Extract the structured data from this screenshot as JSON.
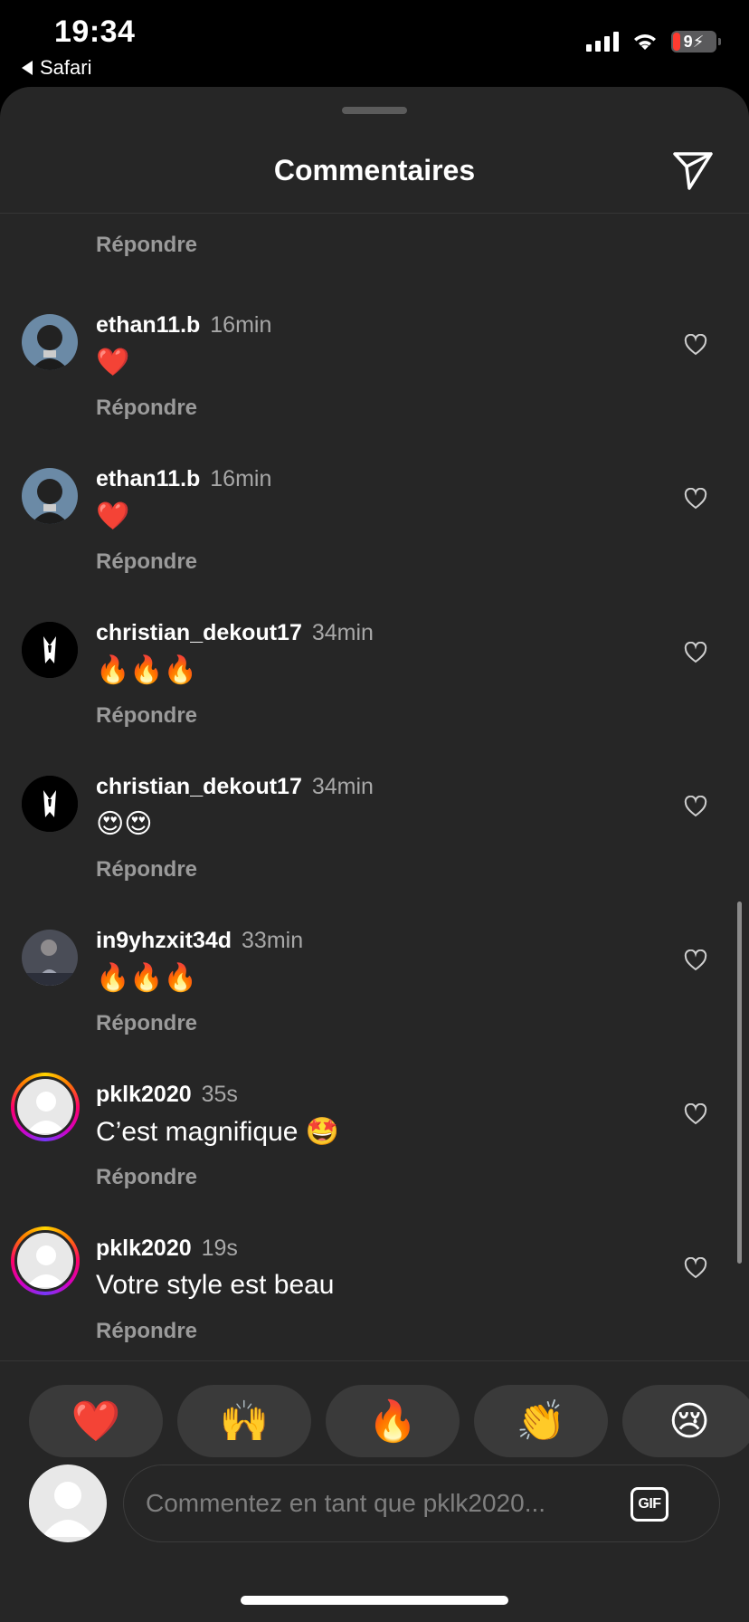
{
  "status_bar": {
    "time": "19:34",
    "back_app": "Safari",
    "battery": "9"
  },
  "header": {
    "title": "Commentaires"
  },
  "comments_top_reply": "Répondre",
  "comments": [
    {
      "user": "ethan11.b",
      "time": "16min",
      "text": "❤️",
      "reply": "Répondre",
      "avatar": "photo"
    },
    {
      "user": "ethan11.b",
      "time": "16min",
      "text": "❤️",
      "reply": "Répondre",
      "avatar": "photo"
    },
    {
      "user": "christian_dekout17",
      "time": "34min",
      "text": "🔥🔥🔥",
      "reply": "Répondre",
      "avatar": "tux"
    },
    {
      "user": "christian_dekout17",
      "time": "34min",
      "text": "😍😍",
      "reply": "Répondre",
      "avatar": "tux"
    },
    {
      "user": "in9yhzxit34d",
      "time": "33min",
      "text": "🔥🔥🔥",
      "reply": "Répondre",
      "avatar": "photo2"
    },
    {
      "user": "pklk2020",
      "time": "35s",
      "text": "C’est magnifique 🤩",
      "reply": "Répondre",
      "avatar": "default-ring"
    },
    {
      "user": "pklk2020",
      "time": "19s",
      "text": "Votre style est beau",
      "reply": "Répondre",
      "avatar": "default-ring"
    }
  ],
  "reactions": [
    "❤️",
    "🙌",
    "🔥",
    "👏",
    "😢"
  ],
  "composer": {
    "placeholder": "Commentez en tant que pklk2020...",
    "gif_label": "GIF"
  }
}
